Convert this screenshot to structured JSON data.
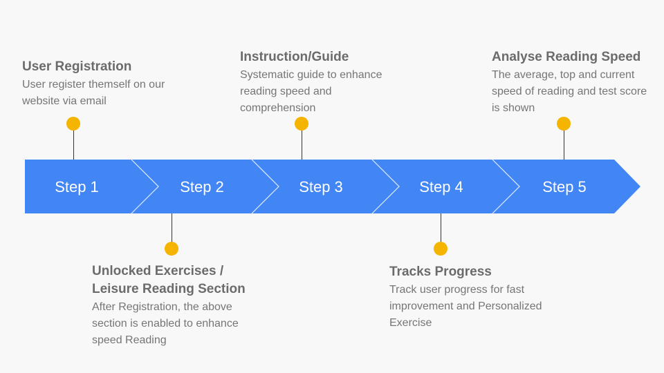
{
  "colors": {
    "background": "#f8f8f8",
    "arrow": "#4285f4",
    "dot": "#f4b400",
    "title_text": "#6b6b6b",
    "desc_text": "#757575"
  },
  "steps": [
    {
      "label": "Step 1",
      "title": "User Registration",
      "desc": "User register themself on our website via email"
    },
    {
      "label": "Step 2",
      "title": "Unlocked Exercises / Leisure Reading Section",
      "desc": "After Registration, the above section is enabled to enhance speed Reading"
    },
    {
      "label": "Step 3",
      "title": "Instruction/Guide",
      "desc": "Systematic guide to enhance reading speed and comprehension"
    },
    {
      "label": "Step 4",
      "title": "Tracks Progress",
      "desc": "Track user progress for fast improvement and Personalized Exercise"
    },
    {
      "label": "Step 5",
      "title": "Analyse Reading Speed",
      "desc": "The average, top and current speed of reading and test score is shown"
    }
  ]
}
